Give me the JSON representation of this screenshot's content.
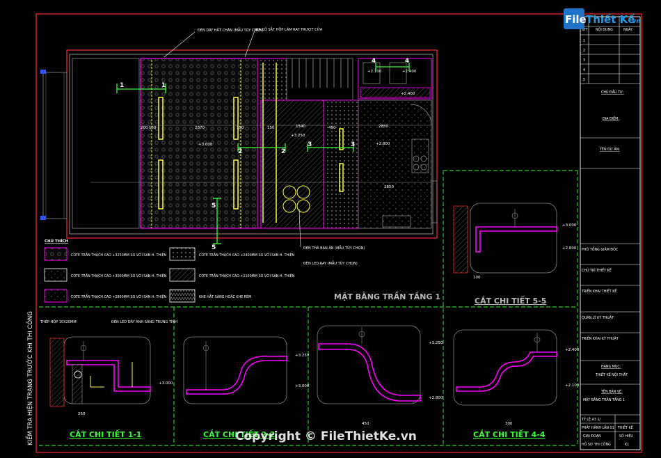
{
  "logo": {
    "word1": "File",
    "word2": "Thiết Kế",
    "suffix": ".vn"
  },
  "watermark": "Copyright © FileThietKe.vn",
  "vertical_note": "KIỂM TRA HIỆN TRẠNG TRƯỚC KHI THI CÔNG",
  "plan": {
    "title": "MẶT BẰNG TRẦN TẦNG 1",
    "annotations": {
      "top_left": "ĐÈN DÂY HẮT CHÂN (MẪU TÙY CHỌN)",
      "top_mid": "GIA CỐ SẮT HỘP LÀM RAY TRƯỢT CỬA",
      "lamp1": "ĐÈN THẢ BÀN ĂN (MẪU TÙY CHỌN)",
      "lamp2": "ĐÈN LED RAY (MẪU TÙY CHỌN)"
    },
    "levels": [
      "+2.400",
      "+2.100",
      "+2.400",
      "+3.000",
      "+3.250",
      "+2.800"
    ],
    "section_marks": [
      "1",
      "1",
      "2",
      "2",
      "3",
      "3",
      "4",
      "4",
      "5",
      "5"
    ],
    "dims": [
      "200",
      "150",
      "2370",
      "150",
      "150",
      "1540",
      "450",
      "2850",
      "2850"
    ]
  },
  "legend": {
    "title": "CHÚ THÍCH",
    "items": [
      "COTE TRẦN THẠCH CAO +3250MM SO VỚI SÀN H. THIỆN",
      "COTE TRẦN THẠCH CAO +2400MM SO VỚI SÀN H. THIỆN",
      "COTE TRẦN THẠCH CAO +3000MM SO VỚI SÀN H. THIỆN",
      "COTE TRẦN THẠCH CAO +2100MM SO VỚI SÀN H. THIỆN",
      "COTE TRẦN THẠCH CAO +2800MM SO VỚI SÀN H. THIỆN",
      "KHE HẮT SÁNG HOẶC KHE RÈM"
    ]
  },
  "details": [
    {
      "title": "CẮT CHI TIẾT 1-1",
      "levels": [
        "+3.000"
      ],
      "dim": "250",
      "notes": [
        "THÉP HỘP 10X20MM",
        "ĐÈN LED DÂY ÁNH SÁNG TRUNG TÍNH"
      ]
    },
    {
      "title": "CẮT CHI TIẾT 2-2",
      "levels": [
        "+3.250",
        "+3.000"
      ],
      "dim": ""
    },
    {
      "title": "CẮT CHI TIẾT 3-3",
      "levels": [
        "+3.250",
        "+2.800"
      ],
      "dim": "450"
    },
    {
      "title": "CẮT CHI TIẾT 4-4",
      "levels": [
        "+2.400",
        "+2.100"
      ],
      "dim": "300"
    },
    {
      "title": "CẮT CHI TIẾT 5-5",
      "levels": [
        "+3.000",
        "+2.800"
      ],
      "dim": "100"
    }
  ],
  "titleblock": {
    "rev_headers": [
      "STT",
      "NỘI DUNG",
      "NGÀY"
    ],
    "rev_rows": [
      "1",
      "2",
      "3",
      "4",
      "5"
    ],
    "owner": "CHỦ ĐẦU TƯ:",
    "location": "ĐỊA ĐIỂM:",
    "project": "TÊN DỰ ÁN:",
    "roles": [
      "PHÓ TỔNG GIÁM ĐỐC",
      "CHỦ TRÌ THIẾT KẾ",
      "TRIỂN KHAI THIẾT KẾ",
      "QUẢN LÝ KỸ THUẬT",
      "TRIỂN KHAI KỸ THUẬT"
    ],
    "category_label": "HẠNG MỤC:",
    "category": "THIẾT KẾ NỘI THẤT",
    "drawing_label": "TÊN BẢN VẼ:",
    "drawing_name": "MẶT BẰNG TRẦN TẦNG 1",
    "scale": "TỶ LỆ A3  1/",
    "release": "PHÁT HÀNH LẦN 01",
    "design": "THIẾT KẾ",
    "phase_label": "GIAI ĐOẠN",
    "phase": "HỒ SƠ THI CÔNG",
    "sheet_label": "SỐ HIỆU",
    "sheet": "K1"
  },
  "colors": {
    "frame": "#ff2a2a",
    "magenta": "#ff00ff",
    "yellow": "#ffff33",
    "green": "#33ff33",
    "gray": "#8a8a8a",
    "white": "#ffffff",
    "title_gray": "#b8b8b8"
  }
}
